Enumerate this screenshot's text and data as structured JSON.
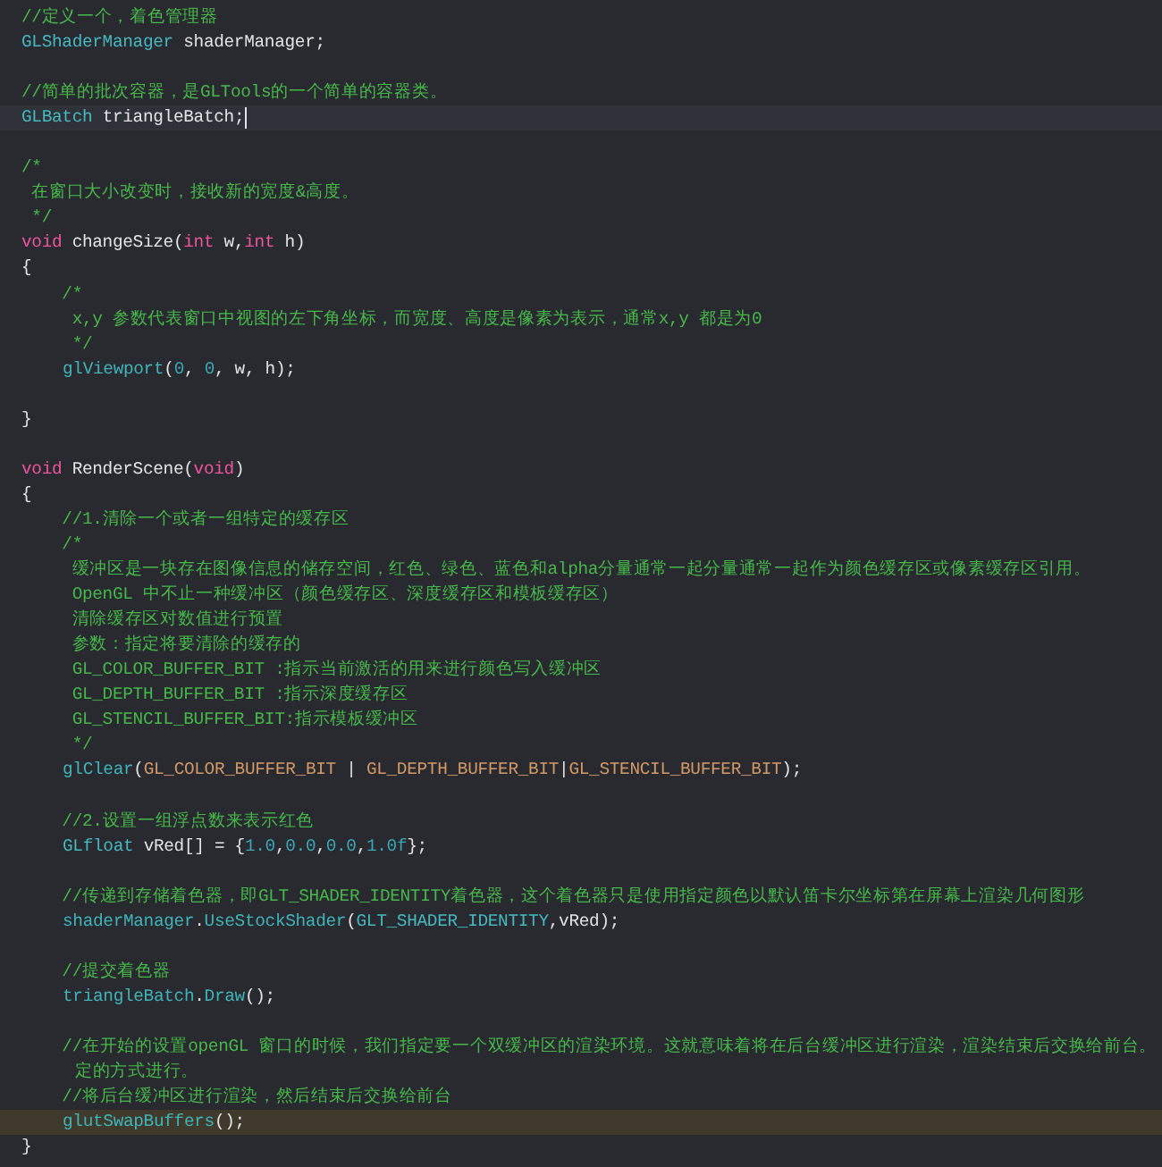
{
  "editor": {
    "lines": [
      {
        "kind": "code",
        "tokens": [
          {
            "kind": "comment",
            "text": "//定义一个，着色管理器"
          }
        ]
      },
      {
        "kind": "code",
        "tokens": [
          {
            "kind": "type",
            "text": "GLShaderManager"
          },
          {
            "kind": "plain",
            "text": " shaderManager;"
          }
        ]
      },
      {
        "kind": "blank"
      },
      {
        "kind": "code",
        "tokens": [
          {
            "kind": "comment",
            "text": "//简单的批次容器，是GLTools的一个简单的容器类。"
          }
        ]
      },
      {
        "kind": "code",
        "current": true,
        "cursor": true,
        "tokens": [
          {
            "kind": "type",
            "text": "GLBatch"
          },
          {
            "kind": "plain",
            "text": " triangleBatch;"
          }
        ]
      },
      {
        "kind": "blank"
      },
      {
        "kind": "code",
        "tokens": [
          {
            "kind": "comment",
            "text": "/*"
          }
        ]
      },
      {
        "kind": "code",
        "tokens": [
          {
            "kind": "comment",
            "text": " 在窗口大小改变时，接收新的宽度&高度。"
          }
        ]
      },
      {
        "kind": "code",
        "tokens": [
          {
            "kind": "comment",
            "text": " */"
          }
        ]
      },
      {
        "kind": "code",
        "tokens": [
          {
            "kind": "keyword",
            "text": "void"
          },
          {
            "kind": "plain",
            "text": " changeSize("
          },
          {
            "kind": "keyword",
            "text": "int"
          },
          {
            "kind": "plain",
            "text": " w,"
          },
          {
            "kind": "keyword",
            "text": "int"
          },
          {
            "kind": "plain",
            "text": " h)"
          }
        ]
      },
      {
        "kind": "code",
        "tokens": [
          {
            "kind": "plain",
            "text": "{"
          }
        ]
      },
      {
        "kind": "code",
        "tokens": [
          {
            "kind": "comment",
            "text": "    /*"
          }
        ]
      },
      {
        "kind": "code",
        "tokens": [
          {
            "kind": "comment",
            "text": "     x,y 参数代表窗口中视图的左下角坐标，而宽度、高度是像素为表示，通常x,y 都是为0"
          }
        ]
      },
      {
        "kind": "code",
        "tokens": [
          {
            "kind": "comment",
            "text": "     */"
          }
        ]
      },
      {
        "kind": "code",
        "indented": true,
        "tokens": [
          {
            "kind": "func",
            "text": "glViewport"
          },
          {
            "kind": "plain",
            "text": "("
          },
          {
            "kind": "number",
            "text": "0"
          },
          {
            "kind": "plain",
            "text": ", "
          },
          {
            "kind": "number",
            "text": "0"
          },
          {
            "kind": "plain",
            "text": ", w, h);"
          }
        ]
      },
      {
        "kind": "blank"
      },
      {
        "kind": "code",
        "tokens": [
          {
            "kind": "plain",
            "text": "}"
          }
        ]
      },
      {
        "kind": "blank"
      },
      {
        "kind": "code",
        "tokens": [
          {
            "kind": "keyword",
            "text": "void"
          },
          {
            "kind": "plain",
            "text": " RenderScene("
          },
          {
            "kind": "keyword",
            "text": "void"
          },
          {
            "kind": "plain",
            "text": ")"
          }
        ]
      },
      {
        "kind": "code",
        "tokens": [
          {
            "kind": "plain",
            "text": "{"
          }
        ]
      },
      {
        "kind": "code",
        "tokens": [
          {
            "kind": "comment",
            "text": "    //1.清除一个或者一组特定的缓存区"
          }
        ]
      },
      {
        "kind": "code",
        "tokens": [
          {
            "kind": "comment",
            "text": "    /*"
          }
        ]
      },
      {
        "kind": "code",
        "tokens": [
          {
            "kind": "comment",
            "text": "     缓冲区是一块存在图像信息的储存空间，红色、绿色、蓝色和alpha分量通常一起分量通常一起作为颜色缓存区或像素缓存区引用。"
          }
        ]
      },
      {
        "kind": "code",
        "tokens": [
          {
            "kind": "comment",
            "text": "     OpenGL 中不止一种缓冲区（颜色缓存区、深度缓存区和模板缓存区）"
          }
        ]
      },
      {
        "kind": "code",
        "tokens": [
          {
            "kind": "comment",
            "text": "     清除缓存区对数值进行预置"
          }
        ]
      },
      {
        "kind": "code",
        "tokens": [
          {
            "kind": "comment",
            "text": "     参数：指定将要清除的缓存的"
          }
        ]
      },
      {
        "kind": "code",
        "tokens": [
          {
            "kind": "comment",
            "text": "     GL_COLOR_BUFFER_BIT :指示当前激活的用来进行颜色写入缓冲区"
          }
        ]
      },
      {
        "kind": "code",
        "tokens": [
          {
            "kind": "comment",
            "text": "     GL_DEPTH_BUFFER_BIT :指示深度缓存区"
          }
        ]
      },
      {
        "kind": "code",
        "tokens": [
          {
            "kind": "comment",
            "text": "     GL_STENCIL_BUFFER_BIT:指示模板缓冲区"
          }
        ]
      },
      {
        "kind": "code",
        "tokens": [
          {
            "kind": "comment",
            "text": "     */"
          }
        ]
      },
      {
        "kind": "code",
        "indented": true,
        "tokens": [
          {
            "kind": "func",
            "text": "glClear"
          },
          {
            "kind": "plain",
            "text": "("
          },
          {
            "kind": "macro",
            "text": "GL_COLOR_BUFFER_BIT"
          },
          {
            "kind": "plain",
            "text": " | "
          },
          {
            "kind": "macro",
            "text": "GL_DEPTH_BUFFER_BIT"
          },
          {
            "kind": "plain",
            "text": "|"
          },
          {
            "kind": "macro",
            "text": "GL_STENCIL_BUFFER_BIT"
          },
          {
            "kind": "plain",
            "text": ");"
          }
        ]
      },
      {
        "kind": "blank"
      },
      {
        "kind": "code",
        "tokens": [
          {
            "kind": "comment",
            "text": "    //2.设置一组浮点数来表示红色"
          }
        ]
      },
      {
        "kind": "code",
        "indented": true,
        "tokens": [
          {
            "kind": "type",
            "text": "GLfloat"
          },
          {
            "kind": "plain",
            "text": " vRed[] = {"
          },
          {
            "kind": "number",
            "text": "1.0"
          },
          {
            "kind": "plain",
            "text": ","
          },
          {
            "kind": "number",
            "text": "0.0"
          },
          {
            "kind": "plain",
            "text": ","
          },
          {
            "kind": "number",
            "text": "0.0"
          },
          {
            "kind": "plain",
            "text": ","
          },
          {
            "kind": "number",
            "text": "1.0f"
          },
          {
            "kind": "plain",
            "text": "};"
          }
        ]
      },
      {
        "kind": "blank"
      },
      {
        "kind": "code",
        "tokens": [
          {
            "kind": "comment",
            "text": "    //传递到存储着色器，即GLT_SHADER_IDENTITY着色器，这个着色器只是使用指定颜色以默认笛卡尔坐标第在屏幕上渲染几何图形"
          }
        ]
      },
      {
        "kind": "code",
        "indented": true,
        "tokens": [
          {
            "kind": "func",
            "text": "shaderManager"
          },
          {
            "kind": "plain",
            "text": "."
          },
          {
            "kind": "func",
            "text": "UseStockShader"
          },
          {
            "kind": "plain",
            "text": "("
          },
          {
            "kind": "type",
            "text": "GLT_SHADER_IDENTITY"
          },
          {
            "kind": "plain",
            "text": ",vRed);"
          }
        ]
      },
      {
        "kind": "blank"
      },
      {
        "kind": "code",
        "tokens": [
          {
            "kind": "comment",
            "text": "    //提交着色器"
          }
        ]
      },
      {
        "kind": "code",
        "indented": true,
        "tokens": [
          {
            "kind": "func",
            "text": "triangleBatch"
          },
          {
            "kind": "plain",
            "text": "."
          },
          {
            "kind": "func",
            "text": "Draw"
          },
          {
            "kind": "plain",
            "text": "();"
          }
        ]
      },
      {
        "kind": "blank"
      },
      {
        "kind": "code",
        "continuation": "定的方式进行。",
        "tokens": [
          {
            "kind": "comment",
            "text": "    //在开始的设置openGL 窗口的时候，我们指定要一个双缓冲区的渲染环境。这就意味着将在后台缓冲区进行渲染，渲染结束后交换给前台。"
          }
        ]
      },
      {
        "kind": "code",
        "tokens": [
          {
            "kind": "comment",
            "text": "    //将后台缓冲区进行渲染，然后结束后交换给前台"
          }
        ]
      },
      {
        "kind": "code",
        "warning": true,
        "indented": true,
        "tokens": [
          {
            "kind": "func",
            "text": "glutSwapBuffers"
          },
          {
            "kind": "plain",
            "text": "();"
          }
        ]
      },
      {
        "kind": "code",
        "tokens": [
          {
            "kind": "plain",
            "text": "}"
          }
        ]
      }
    ]
  }
}
